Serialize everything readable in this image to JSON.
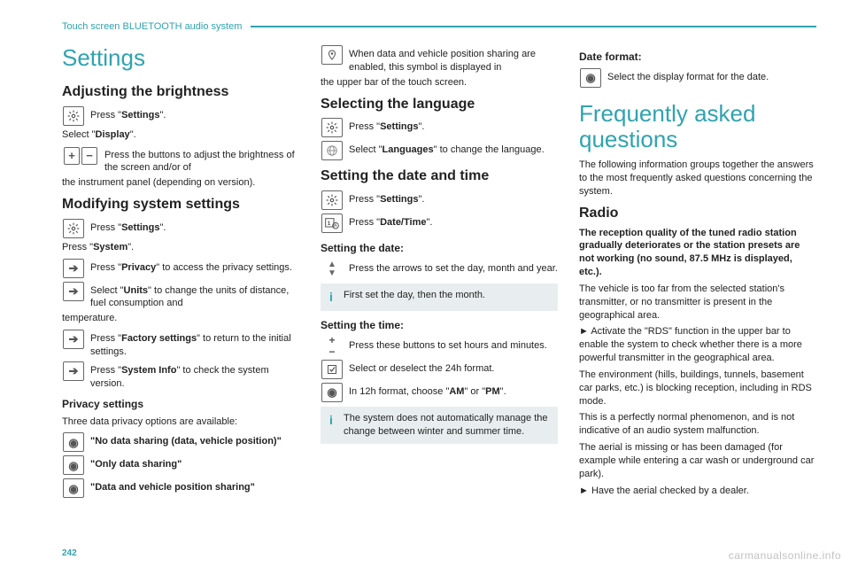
{
  "header": {
    "title": "Touch screen BLUETOOTH audio system"
  },
  "footer": {
    "page": "242"
  },
  "watermark": "carmanualsonline.info",
  "col1": {
    "h1": "Settings",
    "h2a": "Adjusting the brightness",
    "r1": "Press \"",
    "r1b": "Settings",
    "r1c": "\".",
    "p1a": "Select \"",
    "p1b": "Display",
    "p1c": "\".",
    "r2": "Press the buttons to adjust the brightness of the screen and/or of",
    "p2": "the instrument panel (depending on version).",
    "h2b": "Modifying system settings",
    "r3": "Press \"",
    "r3b": "Settings",
    "r3c": "\".",
    "p3a": "Press \"",
    "p3b": "System",
    "p3c": "\".",
    "r4a": "Press \"",
    "r4b": "Privacy",
    "r4c": "\" to access the privacy settings.",
    "r5a": "Select \"",
    "r5b": "Units",
    "r5c": "\" to change the units of distance, fuel consumption and",
    "p4": "temperature.",
    "r6a": "Press \"",
    "r6b": "Factory settings",
    "r6c": "\" to return to the initial settings.",
    "r7a": "Press \"",
    "r7b": "System Info",
    "r7c": "\" to check the system version.",
    "h3": "Privacy settings",
    "p5": "Three data privacy options are available:",
    "r8": "\"No data sharing (data, vehicle position)\"",
    "r9": "\"Only data sharing\"",
    "r10": "\"Data and vehicle position sharing\""
  },
  "col2": {
    "r1": "When data and vehicle position sharing are enabled, this symbol is displayed in",
    "p1": "the upper bar of the touch screen.",
    "h2a": "Selecting the language",
    "r2a": "Press \"",
    "r2b": "Settings",
    "r2c": "\".",
    "r3a": "Select \"",
    "r3b": "Languages",
    "r3c": "\" to change the language.",
    "h2b": "Setting the date and time",
    "r4a": "Press \"",
    "r4b": "Settings",
    "r4c": "\".",
    "r5a": "Press \"",
    "r5b": "Date/Time",
    "r5c": "\".",
    "h3a": "Setting the date:",
    "r6": "Press the arrows to set the day, month and year.",
    "info1": "First set the day, then the month.",
    "h3b": "Setting the time:",
    "r7": "Press these buttons to set hours and minutes.",
    "r8": "Select or deselect the 24h format.",
    "r9a": "In 12h format, choose \"",
    "r9b": "AM",
    "r9c": "\" or \"",
    "r9d": "PM",
    "r9e": "\".",
    "info2": "The system does not automatically manage the change between winter and",
    "info2b": "summer time."
  },
  "col3": {
    "h3a": "Date format:",
    "r1": "Select the display format for the date.",
    "h1": "Frequently asked questions",
    "p1": "The following information groups together the answers to the most frequently asked questions concerning the system.",
    "h2": "Radio",
    "p2": "The reception quality of the tuned radio station gradually deteriorates or the station presets are not working (no sound, 87.5 MHz is displayed, etc.).",
    "p3": "The vehicle is too far from the selected station's transmitter, or no transmitter is present in the geographical area.",
    "p4": "►  Activate the \"RDS\" function in the upper bar to enable the system to check whether there is a more powerful transmitter in the geographical area.",
    "p5": "The environment (hills, buildings, tunnels, basement car parks, etc.) is blocking reception, including in RDS mode.",
    "p6": "This is a perfectly normal phenomenon, and is not indicative of an audio system malfunction.",
    "p7": "The aerial is missing or has been damaged (for example while entering a car wash or underground car park).",
    "p8": "►  Have the aerial checked by a dealer."
  }
}
